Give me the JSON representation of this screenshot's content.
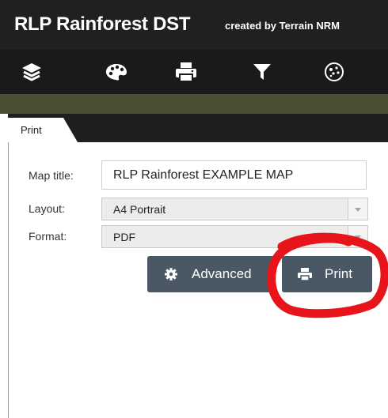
{
  "header": {
    "title": "RLP Rainforest DST",
    "credit": "created by Terrain NRM"
  },
  "toolbar": {
    "tools": [
      {
        "icon": "layers-icon"
      },
      {
        "icon": "legend-icon"
      },
      {
        "icon": "print-icon"
      },
      {
        "icon": "filter-icon"
      },
      {
        "icon": "basemap-icon"
      }
    ]
  },
  "print_tab": {
    "label": "Print"
  },
  "form": {
    "map_title_label": "Map title:",
    "map_title_value": "RLP Rainforest EXAMPLE MAP",
    "layout_label": "Layout:",
    "layout_value": "A4 Portrait",
    "format_label": "Format:",
    "format_value": "PDF"
  },
  "buttons": {
    "advanced_label": "Advanced",
    "print_label": "Print"
  },
  "colors": {
    "header_bg": "#202020",
    "toolbar_bg": "#1a1a1a",
    "accent_bar": "#4a4f34",
    "button_bg": "#4a5865",
    "annotation": "#e8141c"
  }
}
